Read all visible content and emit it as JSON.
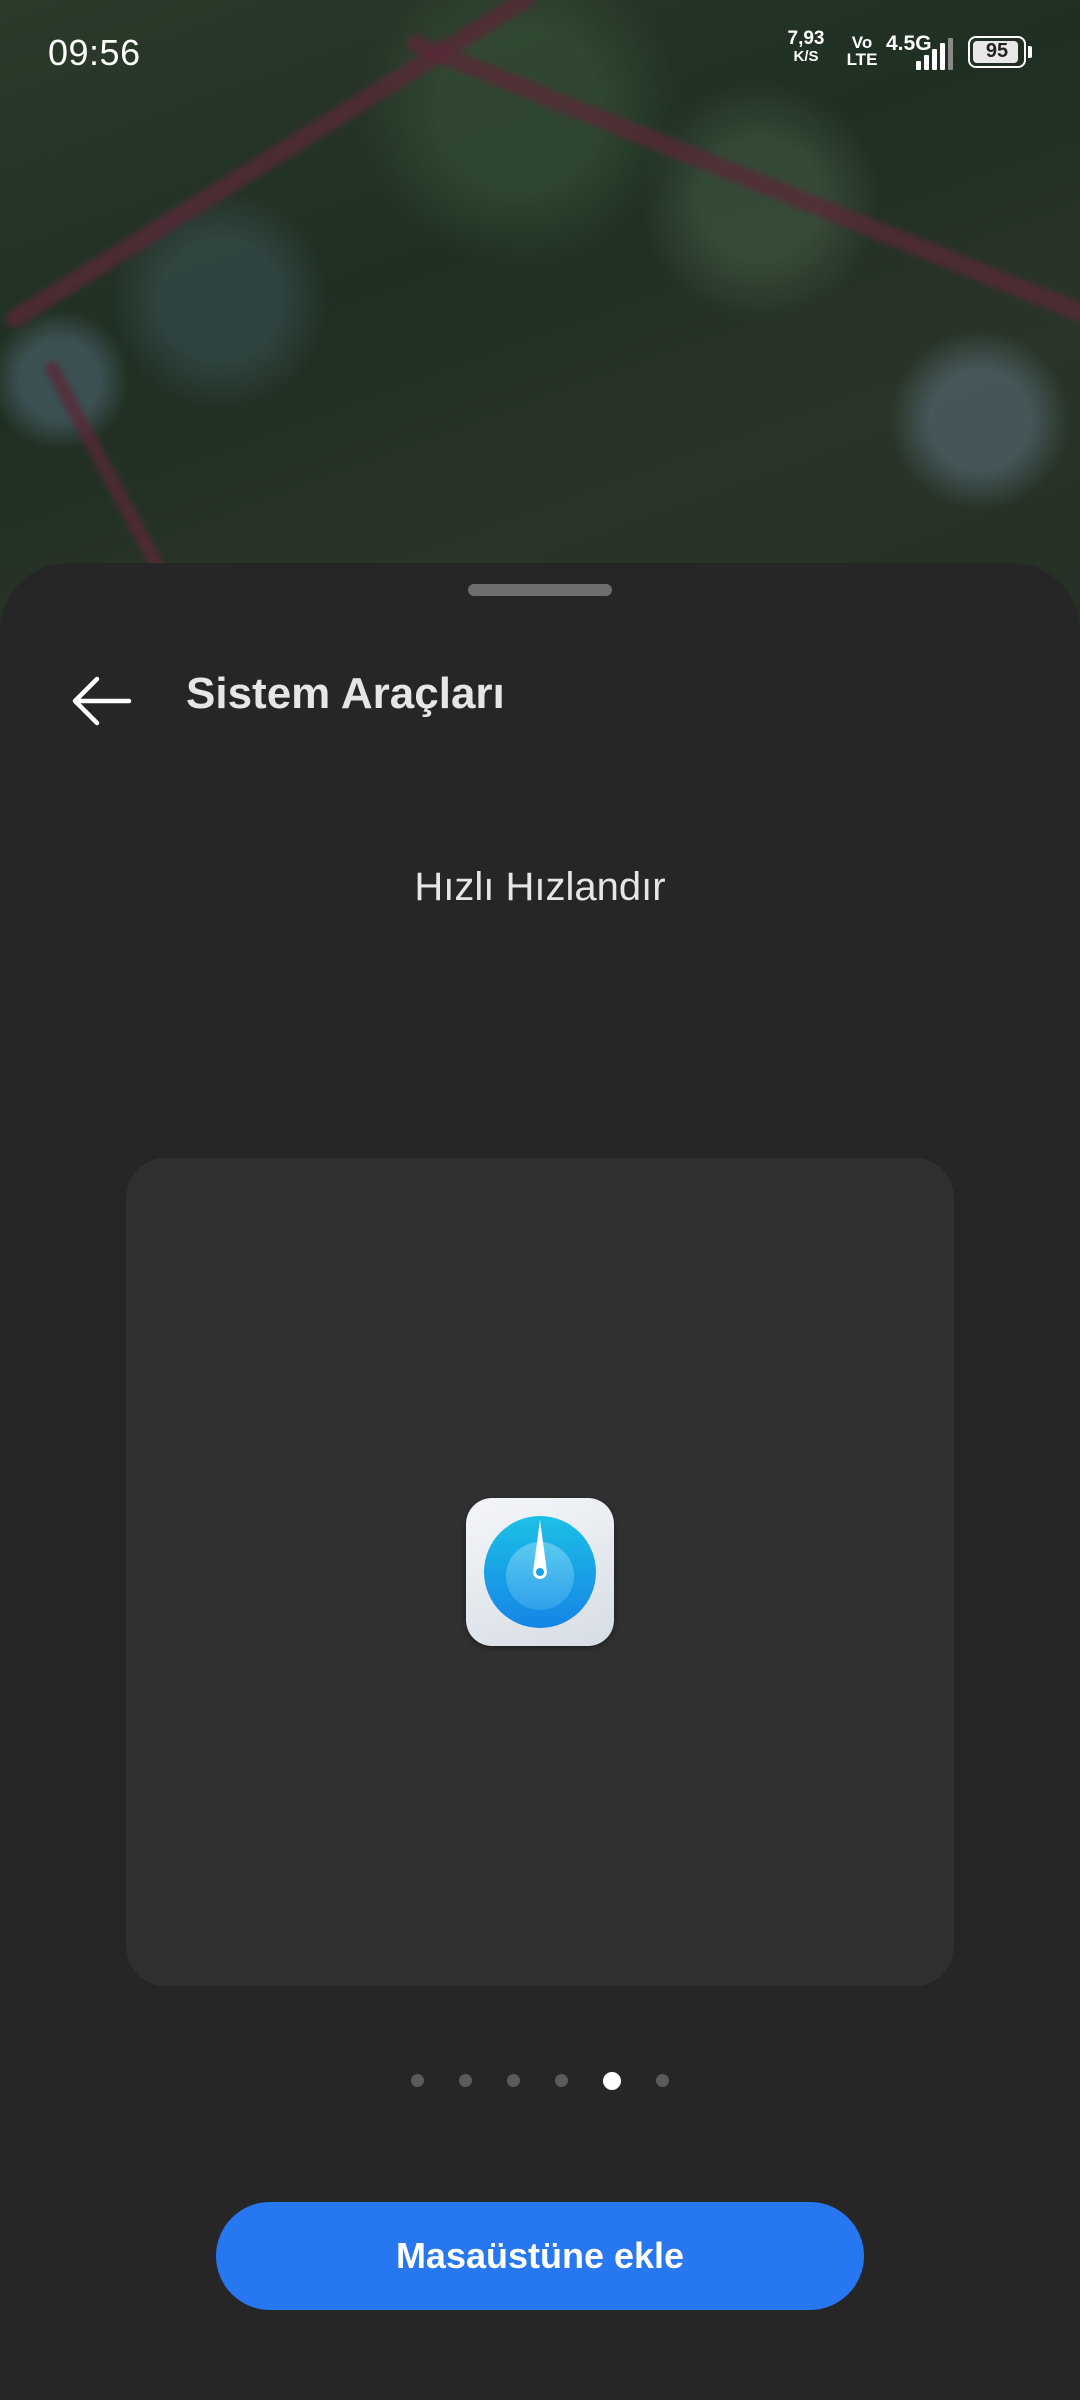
{
  "status_bar": {
    "time": "09:56",
    "net_speed_value": "7,93",
    "net_speed_unit": "K/S",
    "volte_top": "Vo",
    "volte_bottom": "LTE",
    "network_type": "4.5G",
    "signal_bars": 4,
    "battery_level": "95"
  },
  "sheet": {
    "title": "Sistem Araçları",
    "back_icon": "arrow-left-icon"
  },
  "widget": {
    "name": "Hızlı Hızlandır",
    "icon": "speedometer-icon",
    "icon_colors": {
      "outer": "#1aa3e8",
      "inner": "#5cc6f0",
      "needle": "#ffffff"
    }
  },
  "pagination": {
    "total": 6,
    "active_index": 4
  },
  "action": {
    "add_label": "Masaüstüne ekle",
    "color": "#2677f0"
  }
}
